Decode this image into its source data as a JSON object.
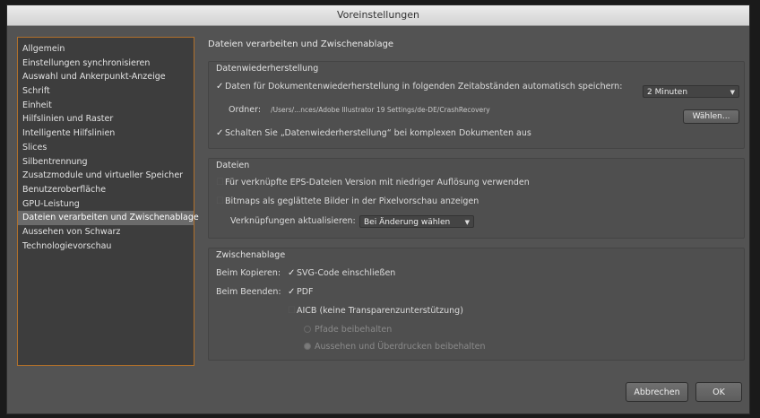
{
  "window": {
    "title": "Voreinstellungen"
  },
  "sidebar": {
    "items": [
      {
        "label": "Allgemein"
      },
      {
        "label": "Einstellungen synchronisieren"
      },
      {
        "label": "Auswahl und Ankerpunkt-Anzeige"
      },
      {
        "label": "Schrift"
      },
      {
        "label": "Einheit"
      },
      {
        "label": "Hilfslinien und Raster"
      },
      {
        "label": "Intelligente Hilfslinien"
      },
      {
        "label": "Slices"
      },
      {
        "label": "Silbentrennung"
      },
      {
        "label": "Zusatzmodule und virtueller Speicher"
      },
      {
        "label": "Benutzeroberfläche"
      },
      {
        "label": "GPU-Leistung"
      },
      {
        "label": "Dateien verarbeiten und Zwischenablage"
      },
      {
        "label": "Aussehen von Schwarz"
      },
      {
        "label": "Technologievorschau"
      }
    ],
    "selected": "Dateien verarbeiten und Zwischenablage"
  },
  "content": {
    "title": "Dateien verarbeiten und Zwischenablage",
    "recovery": {
      "title": "Datenwiederherstellung",
      "autosave_label": "Daten für Dokumentenwiederherstellung in folgenden Zeitabständen automatisch speichern:",
      "autosave_checked": true,
      "interval_value": "2 Minuten",
      "folder_label": "Ordner:",
      "folder_path": "/Users/...nces/Adobe Illustrator 19 Settings/de-DE/CrashRecovery",
      "choose_button": "Wählen...",
      "disable_label": "Schalten Sie „Datenwiederherstellung“ bei komplexen Dokumenten aus",
      "disable_checked": true
    },
    "files": {
      "title": "Dateien",
      "eps_label": "Für verknüpfte EPS-Dateien Version mit niedriger Auflösung verwenden",
      "bitmap_label": "Bitmaps als geglättete Bilder in der Pixelvorschau anzeigen",
      "update_links_label": "Verknüpfungen aktualisieren:",
      "update_links_value": "Bei Änderung wählen"
    },
    "clipboard": {
      "title": "Zwischenablage",
      "copy_label": "Beim Kopieren:",
      "svg_label": "SVG-Code einschließen",
      "quit_label": "Beim Beenden:",
      "pdf_label": "PDF",
      "aicb_label": "AICB (keine Transparenzunterstützung)",
      "paths_label": "Pfade beibehalten",
      "appearance_label": "Aussehen und Überdrucken beibehalten"
    }
  },
  "footer": {
    "cancel": "Abbrechen",
    "ok": "OK"
  }
}
